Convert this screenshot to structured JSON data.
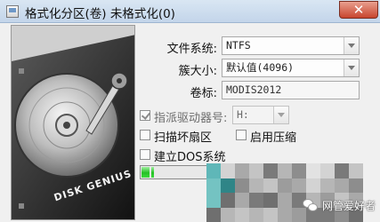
{
  "window": {
    "title": "格式化分区(卷) 未格式化(0)",
    "close_glyph": "✕"
  },
  "disk_art": {
    "brand_text": "DISK GENIUS"
  },
  "form": {
    "filesystem": {
      "label": "文件系统:",
      "value": "NTFS"
    },
    "cluster": {
      "label": "簇大小:",
      "value": "默认值(4096)"
    },
    "volume_label": {
      "label": "卷标:",
      "value": "MODIS2012"
    }
  },
  "options": {
    "assign_letter": {
      "label": "指派驱动器号:",
      "checked": true,
      "disabled": true,
      "value": "H:"
    },
    "scan_bad": {
      "label": "扫描坏扇区",
      "checked": false
    },
    "compress": {
      "label": "启用压缩",
      "checked": false
    },
    "dos_system": {
      "label": "建立DOS系统",
      "checked": false
    }
  },
  "progress": {
    "fraction": 0.06
  },
  "watermark": {
    "text": "网管爱好者",
    "icon": "wechat-icon"
  },
  "colors": {
    "progress_green": "#25c025",
    "titlebar": "#c3d5ea",
    "close_red": "#c8452e",
    "mosaic_teal": "#3f9ea0"
  }
}
